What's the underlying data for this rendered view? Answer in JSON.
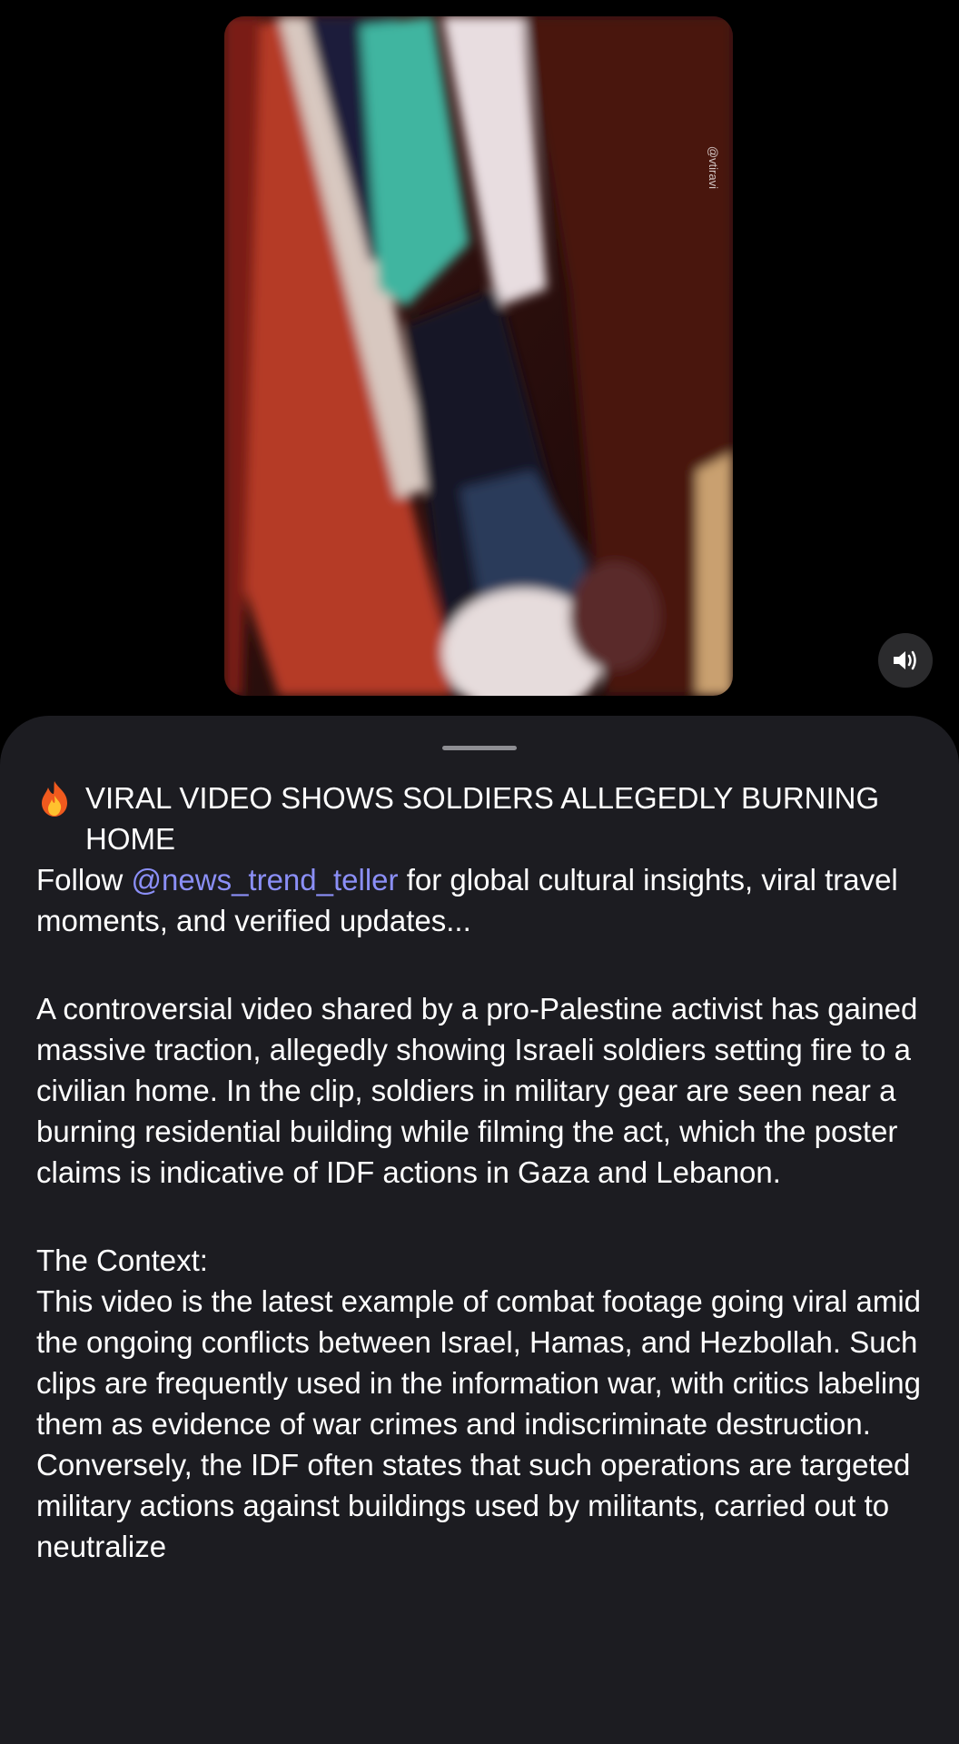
{
  "video": {
    "watermark": "@vtiravi",
    "sound_icon": "speaker-icon"
  },
  "post": {
    "title_icon": "fire-icon",
    "title": "VIRAL VIDEO SHOWS SOLDIERS ALLEGEDLY BURNING HOME",
    "follow_prefix": "Follow ",
    "mention": "@news_trend_teller",
    "follow_suffix": " for global cultural insights, viral travel moments, and verified updates...",
    "paragraph1": "A controversial video shared by a pro-Palestine activist has gained massive traction, allegedly showing Israeli soldiers setting fire to a civilian home. In the clip, soldiers in military gear are seen near a burning residential building while filming the act, which the poster claims is indicative of IDF actions in Gaza and Lebanon.",
    "context_heading": "The Context:",
    "paragraph2": "This video is the latest example of combat footage going viral amid the ongoing conflicts between Israel, Hamas, and Hezbollah. Such clips are frequently used in the information war, with critics labeling them as evidence of war crimes and indiscriminate destruction. Conversely, the IDF often states that such operations are targeted military actions against buildings used by militants, carried out to neutralize"
  }
}
